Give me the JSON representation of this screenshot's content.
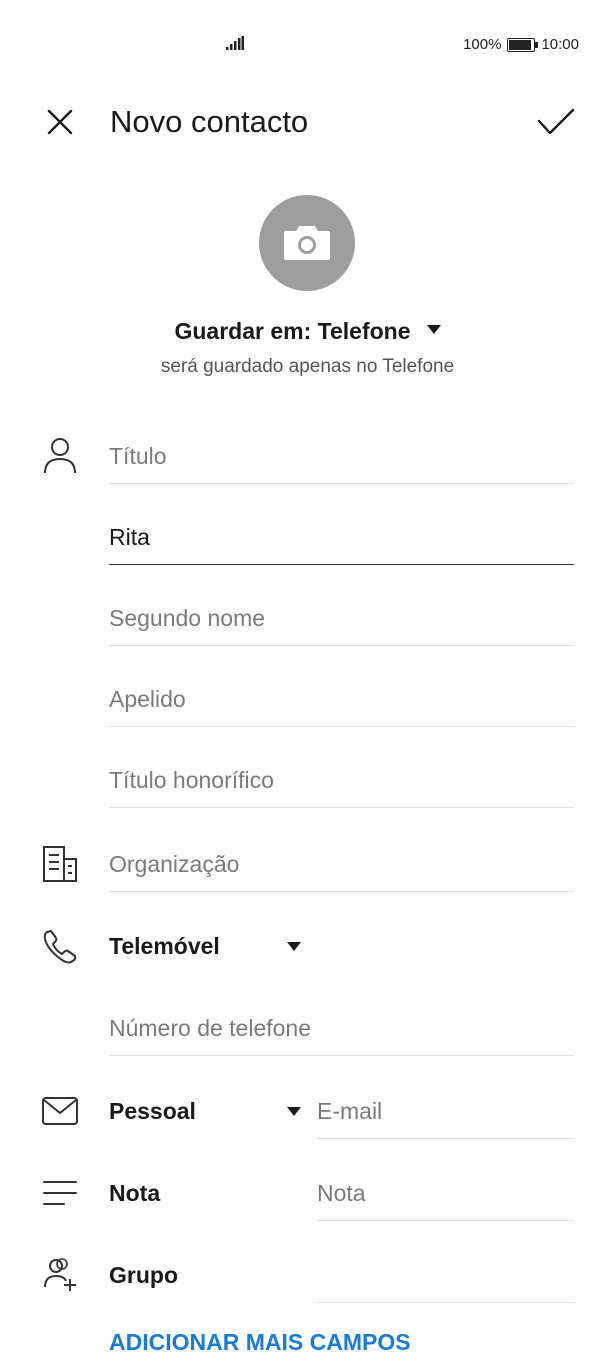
{
  "status_bar": {
    "battery": "100%",
    "time": "10:00"
  },
  "header": {
    "title": "Novo contacto"
  },
  "save_location": {
    "label": "Guardar em: Telefone",
    "subtitle": "será guardado apenas no Telefone"
  },
  "name_fields": {
    "title_placeholder": "Título",
    "first_name_value": "Rita",
    "middle_name_placeholder": "Segundo nome",
    "last_name_placeholder": "Apelido",
    "suffix_placeholder": "Título honorífico"
  },
  "organization": {
    "placeholder": "Organização"
  },
  "phone": {
    "type": "Telemóvel",
    "placeholder": "Número de telefone"
  },
  "email": {
    "type": "Pessoal",
    "placeholder": "E-mail"
  },
  "note": {
    "label": "Nota",
    "placeholder": "Nota"
  },
  "group": {
    "label": "Grupo"
  },
  "add_more_fields": "ADICIONAR MAIS CAMPOS",
  "colors": {
    "accent": "#1a7bd6",
    "avatar_bg": "#9e9e9e"
  }
}
